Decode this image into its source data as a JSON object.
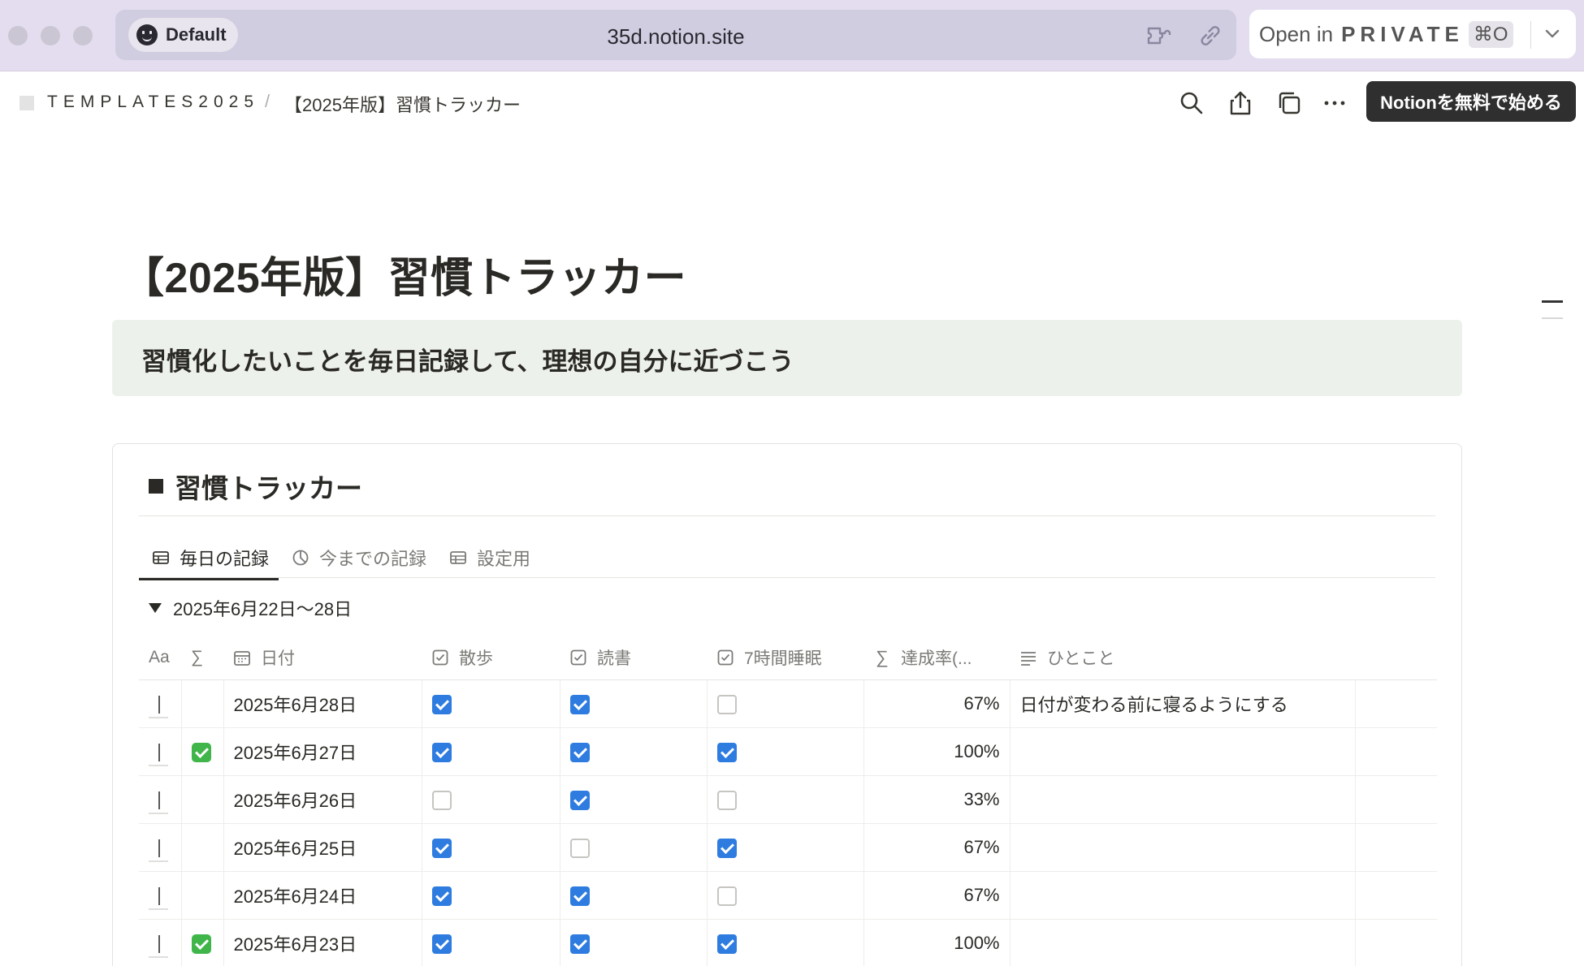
{
  "browser": {
    "profile_label": "Default",
    "url": "35d.notion.site",
    "open_in_label": "Open in",
    "private_label": "PRIVATE",
    "shortcut": "⌘O"
  },
  "topbar": {
    "breadcrumb_root": "TEMPLATES2025",
    "breadcrumb_sep": "/",
    "breadcrumb_page": "【2025年版】習慣トラッカー",
    "cta_label": "Notionを無料で始める"
  },
  "page": {
    "title": "【2025年版】習慣トラッカー",
    "callout": "習慣化したいことを毎日記録して、理想の自分に近づこう"
  },
  "database": {
    "title": "習慣トラッカー",
    "tabs": [
      {
        "label": "毎日の記録",
        "icon": "table-icon",
        "active": true
      },
      {
        "label": "今までの記録",
        "icon": "chart-icon",
        "active": false
      },
      {
        "label": "設定用",
        "icon": "table-icon",
        "active": false
      }
    ],
    "group_label": "2025年6月22日〜28日",
    "columns": {
      "name_icon": "Aa",
      "formula_icon": "∑",
      "date": "日付",
      "walk": "散歩",
      "reading": "読書",
      "sleep": "7時間睡眠",
      "rate": "達成率(...",
      "note": "ひとこと"
    },
    "rows": [
      {
        "done": false,
        "date": "2025年6月28日",
        "walk": true,
        "reading": true,
        "sleep": false,
        "rate": "67%",
        "note": "日付が変わる前に寝るようにする"
      },
      {
        "done": true,
        "date": "2025年6月27日",
        "walk": true,
        "reading": true,
        "sleep": true,
        "rate": "100%",
        "note": ""
      },
      {
        "done": false,
        "date": "2025年6月26日",
        "walk": false,
        "reading": true,
        "sleep": false,
        "rate": "33%",
        "note": ""
      },
      {
        "done": false,
        "date": "2025年6月25日",
        "walk": true,
        "reading": false,
        "sleep": true,
        "rate": "67%",
        "note": ""
      },
      {
        "done": false,
        "date": "2025年6月24日",
        "walk": true,
        "reading": true,
        "sleep": false,
        "rate": "67%",
        "note": ""
      },
      {
        "done": true,
        "date": "2025年6月23日",
        "walk": true,
        "reading": true,
        "sleep": true,
        "rate": "100%",
        "note": ""
      }
    ]
  },
  "colors": {
    "chrome_bg": "#e4ddf0",
    "checkbox_on": "#2e7ce0",
    "callout_bg": "#edf1ec",
    "cta_bg": "#2f2f2f"
  }
}
